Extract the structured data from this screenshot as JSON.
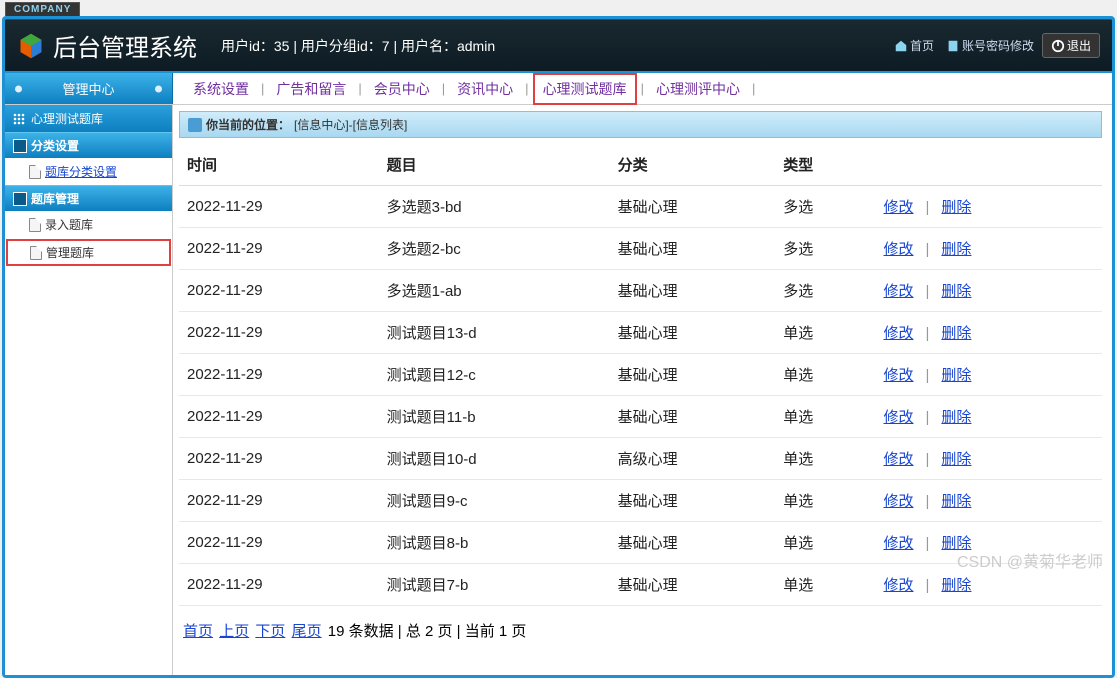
{
  "top_label": "COMPANY",
  "app_title": "后台管理系统",
  "user_info": "用户id：35 | 用户分组id：7 | 用户名：admin",
  "header_links": {
    "home": "首页",
    "password": "账号密码修改",
    "exit": "退出"
  },
  "topnav": {
    "first": "管理中心",
    "items": [
      "系统设置",
      "广告和留言",
      "会员中心",
      "资讯中心",
      "心理测试题库",
      "心理测评中心"
    ],
    "highlighted_index": 4
  },
  "sidebar": {
    "crumb": "心理测试题库",
    "sections": [
      {
        "title": "分类设置",
        "items": [
          {
            "label": "题库分类设置",
            "underline": true,
            "highlighted": false
          }
        ]
      },
      {
        "title": "题库管理",
        "items": [
          {
            "label": "录入题库",
            "underline": false,
            "highlighted": false
          },
          {
            "label": "管理题库",
            "underline": false,
            "highlighted": true
          }
        ]
      }
    ]
  },
  "breadcrumb": {
    "prefix": "你当前的位置：",
    "text": "[信息中心]-[信息列表]"
  },
  "table": {
    "headers": [
      "时间",
      "题目",
      "分类",
      "类型",
      ""
    ],
    "rows": [
      {
        "time": "2022-11-29",
        "title": "多选题3-bd",
        "cat": "基础心理",
        "type": "多选"
      },
      {
        "time": "2022-11-29",
        "title": "多选题2-bc",
        "cat": "基础心理",
        "type": "多选"
      },
      {
        "time": "2022-11-29",
        "title": "多选题1-ab",
        "cat": "基础心理",
        "type": "多选"
      },
      {
        "time": "2022-11-29",
        "title": "测试题目13-d",
        "cat": "基础心理",
        "type": "单选"
      },
      {
        "time": "2022-11-29",
        "title": "测试题目12-c",
        "cat": "基础心理",
        "type": "单选"
      },
      {
        "time": "2022-11-29",
        "title": "测试题目11-b",
        "cat": "基础心理",
        "type": "单选"
      },
      {
        "time": "2022-11-29",
        "title": "测试题目10-d",
        "cat": "高级心理",
        "type": "单选"
      },
      {
        "time": "2022-11-29",
        "title": "测试题目9-c",
        "cat": "基础心理",
        "type": "单选"
      },
      {
        "time": "2022-11-29",
        "title": "测试题目8-b",
        "cat": "基础心理",
        "type": "单选"
      },
      {
        "time": "2022-11-29",
        "title": "测试题目7-b",
        "cat": "基础心理",
        "type": "单选"
      }
    ],
    "actions": {
      "edit": "修改",
      "delete": "删除"
    }
  },
  "pager": {
    "links": [
      "首页",
      "上页",
      "下页",
      "尾页"
    ],
    "info": "19 条数据 | 总 2 页 | 当前 1 页"
  },
  "watermark": "CSDN @黄菊华老师"
}
